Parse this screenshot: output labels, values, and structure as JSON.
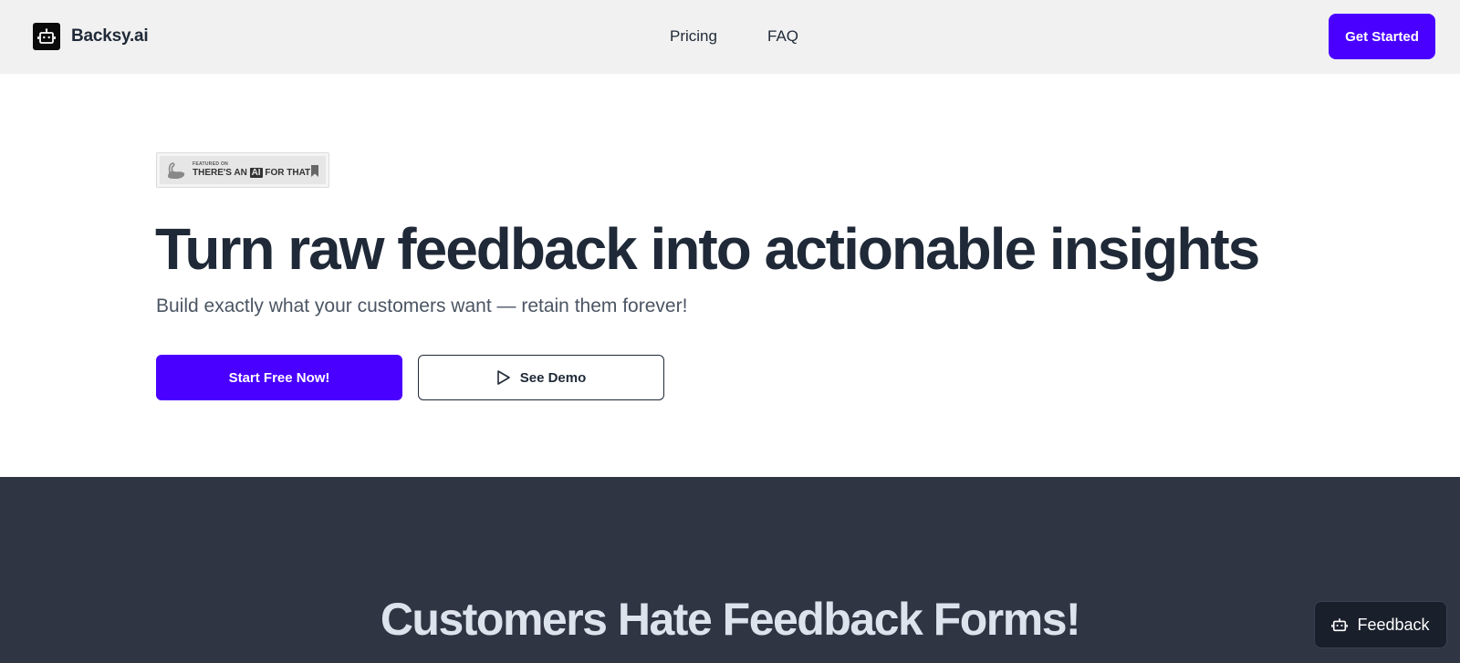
{
  "header": {
    "brand": "Backsy.ai",
    "nav": [
      {
        "label": "Pricing"
      },
      {
        "label": "FAQ"
      }
    ],
    "cta_label": "Get Started",
    "cta_color": "#4a00ff"
  },
  "hero": {
    "badge": {
      "featured_label": "FEATURED ON",
      "text_before": "THERE'S AN",
      "text_ai": "AI",
      "text_after": "FOR THAT"
    },
    "title": "Turn raw feedback into actionable insights",
    "subtitle": "Build exactly what your customers want — retain them forever!",
    "primary_button": "Start Free Now!",
    "secondary_button": "See Demo"
  },
  "section": {
    "title": "Customers Hate Feedback Forms!",
    "background": "#2f3543"
  },
  "widget": {
    "label": "Feedback",
    "icon": "robot-icon"
  }
}
